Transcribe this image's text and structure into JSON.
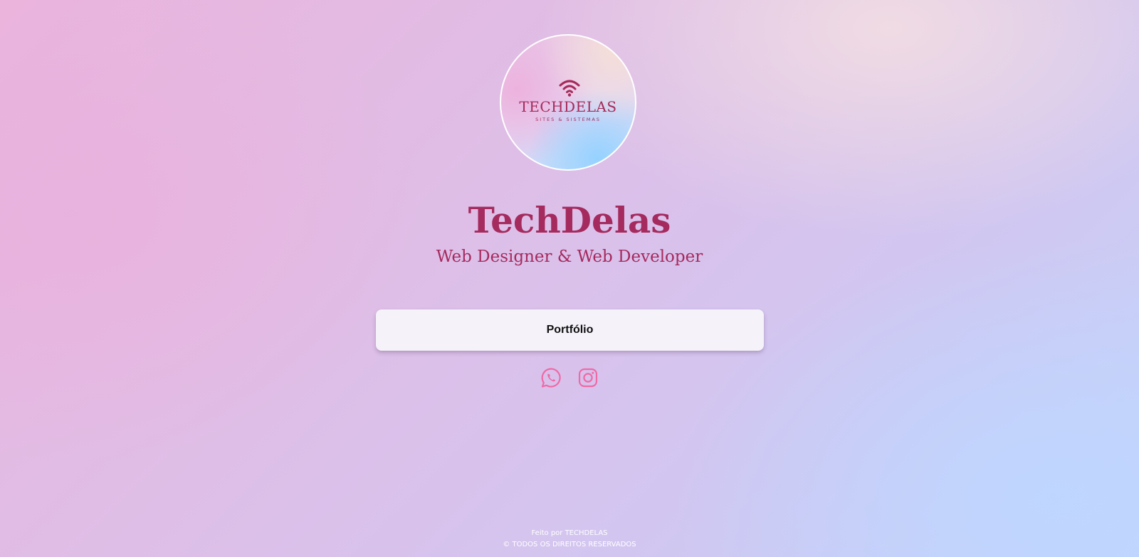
{
  "profile": {
    "avatar": {
      "logo_wordmark": "TECHDELAS",
      "logo_tagline": "SITES & SISTEMAS",
      "icon": "wifi-icon"
    },
    "name": "TechDelas",
    "tagline": "Web Designer & Web Developer"
  },
  "links": [
    {
      "label": "Portfólio"
    }
  ],
  "social": [
    {
      "name": "WhatsApp",
      "icon": "whatsapp-icon"
    },
    {
      "name": "Instagram",
      "icon": "instagram-icon"
    }
  ],
  "footer": {
    "made_by": "Feito por TECHDELAS",
    "rights": "© TODOS OS DIREITOS RESERVADOS"
  },
  "colors": {
    "accent": "#a52a5e",
    "icon_pink": "#f06aa6",
    "button_bg": "#f5f2f9"
  }
}
